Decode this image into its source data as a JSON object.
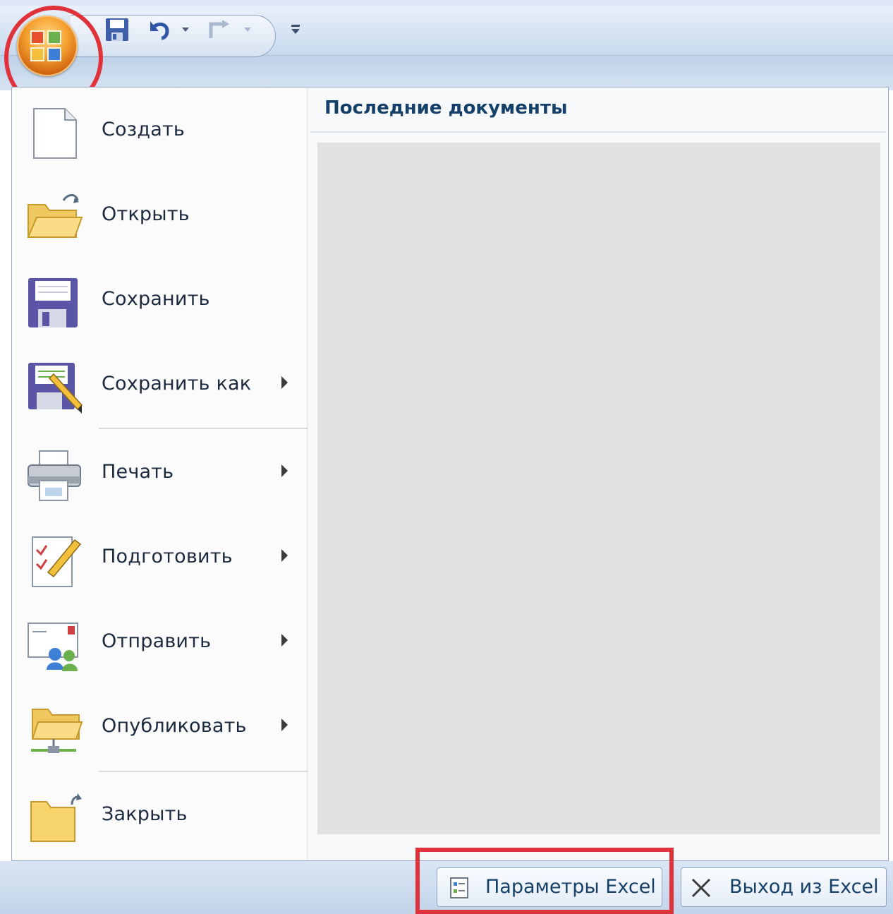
{
  "qat": {
    "items": [
      {
        "name": "save-icon"
      },
      {
        "name": "undo-icon"
      },
      {
        "name": "undo-dropdown-icon"
      },
      {
        "name": "redo-icon"
      },
      {
        "name": "redo-dropdown-icon"
      },
      {
        "name": "customize-qat-icon"
      }
    ]
  },
  "office_button": {
    "icon": "office-logo-icon",
    "highlight_color": "#e0323a"
  },
  "menu": {
    "items": [
      {
        "label": "Создать",
        "icon": "new-document-icon",
        "submenu": false
      },
      {
        "label": "Открыть",
        "icon": "open-folder-icon",
        "submenu": false
      },
      {
        "label": "Сохранить",
        "icon": "save-disk-icon",
        "submenu": false
      },
      {
        "label": "Сохранить как",
        "icon": "save-as-icon",
        "submenu": true
      },
      {
        "label": "Печать",
        "icon": "printer-icon",
        "submenu": true
      },
      {
        "label": "Подготовить",
        "icon": "prepare-document-icon",
        "submenu": true
      },
      {
        "label": "Отправить",
        "icon": "send-icon",
        "submenu": true
      },
      {
        "label": "Опубликовать",
        "icon": "publish-icon",
        "submenu": true
      },
      {
        "label": "Закрыть",
        "icon": "close-folder-icon",
        "submenu": false
      }
    ]
  },
  "recent": {
    "header": "Последние документы"
  },
  "footer": {
    "options_label": "Параметры Excel",
    "exit_label": "Выход из Excel"
  },
  "colors": {
    "accent": "#15406a",
    "highlight": "#e0323a",
    "recent_background": "#e2e2e2"
  }
}
